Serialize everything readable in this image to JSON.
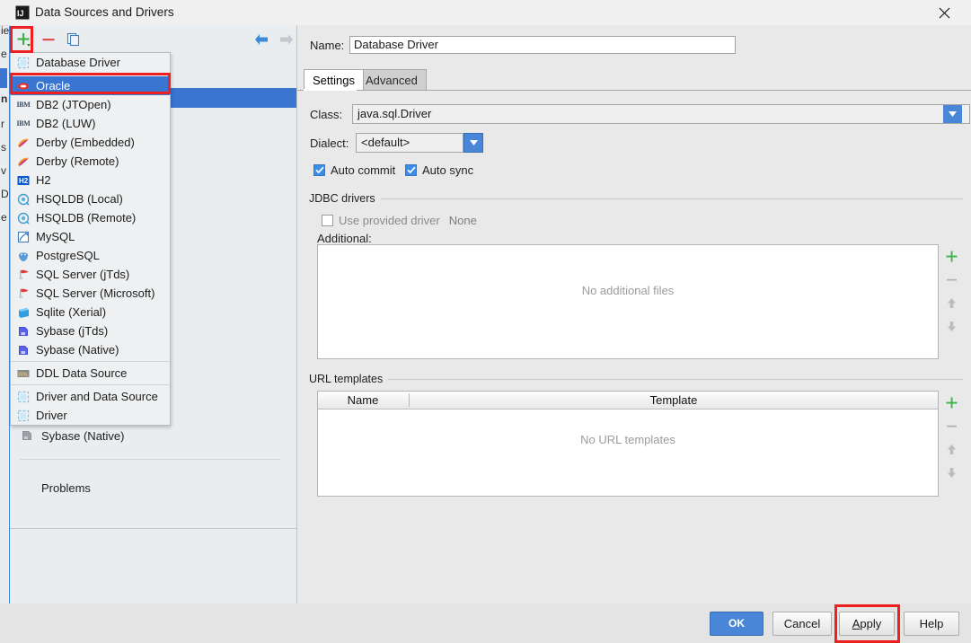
{
  "window": {
    "title": "Data Sources and Drivers",
    "title_icon": "intellij-idea-icon",
    "close_icon": "close-icon"
  },
  "background_app": {
    "edge_letters": [
      "ie",
      "e",
      "n",
      "r",
      "s",
      "v",
      "D",
      "e"
    ],
    "tree_item": "Sybase (Native)",
    "problems_label": "Problems"
  },
  "toolbar": {
    "add_label": "+",
    "add_icon": "plus-icon",
    "remove_icon": "minus-icon",
    "copy_icon": "copy-icon",
    "back_icon": "arrow-left-icon",
    "forward_icon": "arrow-right-icon"
  },
  "popup_menu": {
    "groups": [
      {
        "items": [
          {
            "label": "Database Driver",
            "icon": "driver-icon",
            "selected": false
          }
        ]
      },
      {
        "items": [
          {
            "label": "Oracle",
            "icon": "oracle-icon",
            "selected": true
          },
          {
            "label": "DB2 (JTOpen)",
            "icon": "ibm-icon",
            "selected": false
          },
          {
            "label": "DB2 (LUW)",
            "icon": "ibm-icon",
            "selected": false
          },
          {
            "label": "Derby (Embedded)",
            "icon": "derby-icon",
            "selected": false
          },
          {
            "label": "Derby (Remote)",
            "icon": "derby-icon",
            "selected": false
          },
          {
            "label": "H2",
            "icon": "h2-icon",
            "selected": false
          },
          {
            "label": "HSQLDB (Local)",
            "icon": "hsqldb-icon",
            "selected": false
          },
          {
            "label": "HSQLDB (Remote)",
            "icon": "hsqldb-icon",
            "selected": false
          },
          {
            "label": "MySQL",
            "icon": "mysql-icon",
            "selected": false
          },
          {
            "label": "PostgreSQL",
            "icon": "postgresql-icon",
            "selected": false
          },
          {
            "label": "SQL Server (jTds)",
            "icon": "sqlserver-icon",
            "selected": false
          },
          {
            "label": "SQL Server (Microsoft)",
            "icon": "sqlserver-icon",
            "selected": false
          },
          {
            "label": "Sqlite (Xerial)",
            "icon": "sqlite-icon",
            "selected": false
          },
          {
            "label": "Sybase (jTds)",
            "icon": "sybase-icon",
            "selected": false
          },
          {
            "label": "Sybase (Native)",
            "icon": "sybase-icon",
            "selected": false
          }
        ]
      },
      {
        "items": [
          {
            "label": "DDL Data Source",
            "icon": "ddl-icon",
            "selected": false
          }
        ]
      },
      {
        "items": [
          {
            "label": "Driver and Data Source",
            "icon": "driver-icon",
            "selected": false
          },
          {
            "label": "Driver",
            "icon": "driver-icon",
            "selected": false
          }
        ]
      }
    ]
  },
  "form": {
    "name_label": "Name:",
    "name_value": "Database Driver",
    "tabs": [
      {
        "label": "Settings",
        "active": true
      },
      {
        "label": "Advanced",
        "active": false
      }
    ],
    "class_label": "Class:",
    "class_value": "java.sql.Driver",
    "class_dropdown_icon": "chevron-down-icon",
    "dialect_label": "Dialect:",
    "dialect_value": "<default>",
    "dialect_dropdown_icon": "chevron-down-icon",
    "auto_commit_label": "Auto commit",
    "auto_commit_checked": true,
    "auto_sync_label": "Auto sync",
    "auto_sync_checked": true,
    "jdbc_group_title": "JDBC drivers",
    "use_provided_driver_label": "Use provided driver",
    "use_provided_driver_value": "None",
    "use_provided_driver_checked": false,
    "additional_label": "Additional:",
    "additional_empty_text": "No additional files",
    "url_group_title": "URL templates",
    "url_table_headers": [
      "Name",
      "Template"
    ],
    "url_empty_text": "No URL templates",
    "side_buttons": {
      "add_icon": "plus-icon",
      "remove_icon": "minus-icon",
      "up_icon": "arrow-up-icon",
      "down_icon": "arrow-down-icon"
    }
  },
  "buttons": {
    "ok": "OK",
    "cancel": "Cancel",
    "apply": "Apply",
    "apply_mnemonic": "A",
    "help": "Help"
  },
  "colors": {
    "accent_blue": "#4a86d8",
    "selection_blue": "#3a75d2",
    "annotation_red": "#f01f1f",
    "green_plus": "#3cb44a",
    "red_minus": "#d9534f",
    "panel_bg": "#e9e9e9",
    "tree_bg": "#e9edf0"
  }
}
